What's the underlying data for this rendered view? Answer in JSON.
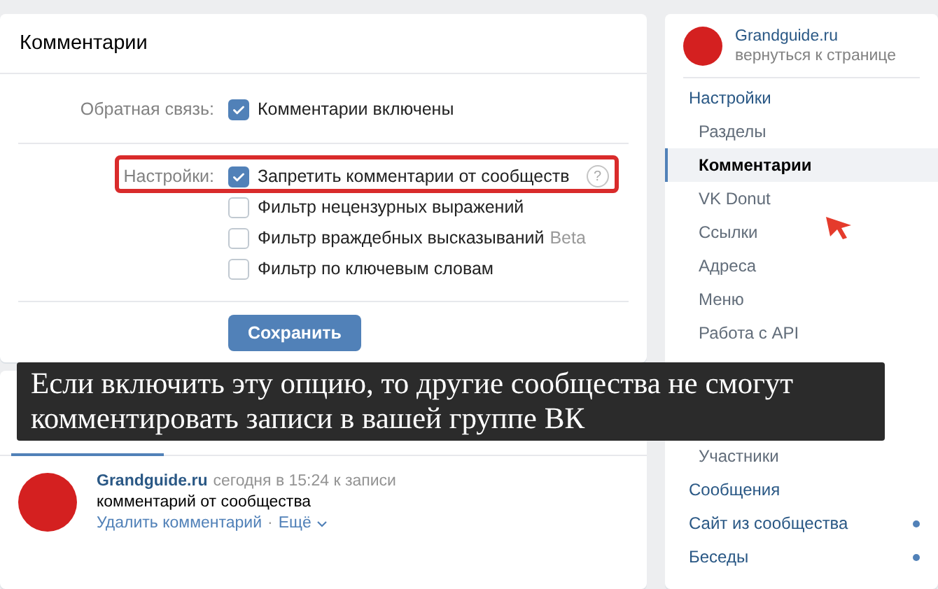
{
  "page_header": {
    "title": "Комментарии"
  },
  "settings": [
    {
      "label": "Обратная связь:",
      "highlighted": false,
      "options": [
        {
          "text": "Комментарии включены",
          "checked": true
        }
      ]
    },
    {
      "label": "Настройки:",
      "highlighted": true,
      "options": [
        {
          "text": "Запретить комментарии от сообществ",
          "checked": true,
          "help": "?"
        },
        {
          "text": "Фильтр нецензурных выражений",
          "checked": false
        },
        {
          "text": "Фильтр враждебных высказываний",
          "checked": false,
          "badge": "Beta"
        },
        {
          "text": "Фильтр по ключевым словам",
          "checked": false
        }
      ]
    }
  ],
  "save_button": "Сохранить",
  "comment": {
    "author": "Grandguide.ru",
    "meta": "сегодня в 15:24 к записи",
    "text": "комментарий от сообщества",
    "actions": [
      "Удалить комментарий",
      "Ещё"
    ],
    "separator": "·"
  },
  "caption": {
    "lines": [
      "Если включить эту опцию, то другие сообщества не смогут",
      "комментировать записи в вашей группе ВК"
    ]
  },
  "sidebar": {
    "group_name": "Grandguide.ru",
    "back_link": "вернуться к странице",
    "items": [
      {
        "label": "Настройки",
        "selected": false,
        "dot": false,
        "children": [
          {
            "label": "Разделы",
            "selected": false
          },
          {
            "label": "Комментарии",
            "selected": true
          },
          {
            "label": "VK Donut",
            "selected": false
          },
          {
            "label": "Ссылки",
            "selected": false
          },
          {
            "label": "Адреса",
            "selected": false
          },
          {
            "label": "Меню",
            "selected": false
          },
          {
            "label": "Работа с API",
            "selected": false
          },
          {
            "label": "Участники",
            "selected": false
          }
        ]
      },
      {
        "label": "Сообщения",
        "selected": false,
        "dot": false
      },
      {
        "label": "Сайт из сообщества",
        "selected": false,
        "dot": true
      },
      {
        "label": "Беседы",
        "selected": false,
        "dot": true
      }
    ]
  }
}
